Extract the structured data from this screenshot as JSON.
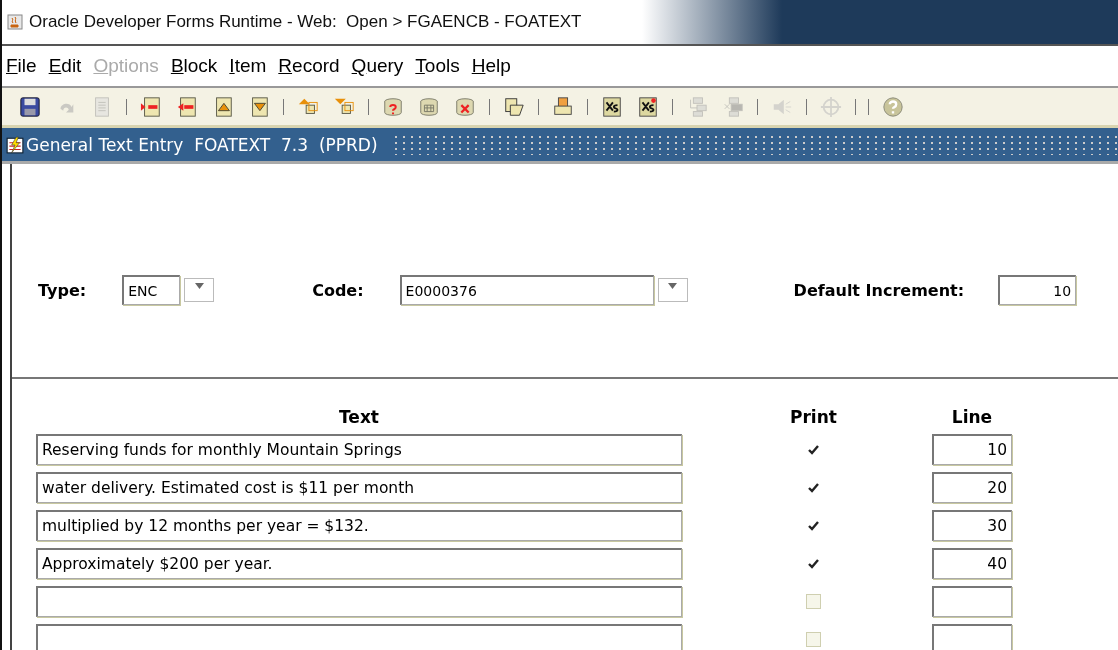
{
  "window": {
    "title": "Oracle Developer Forms Runtime - Web:  Open > FGAENCB - FOATEXT"
  },
  "menu": [
    {
      "label": "File",
      "disabled": false
    },
    {
      "label": "Edit",
      "disabled": false
    },
    {
      "label": "Options",
      "disabled": true
    },
    {
      "label": "Block",
      "disabled": false
    },
    {
      "label": "Item",
      "disabled": false
    },
    {
      "label": "Record",
      "disabled": false
    },
    {
      "label": "Query",
      "disabled": false
    },
    {
      "label": "Tools",
      "disabled": false
    },
    {
      "label": "Help",
      "disabled": false
    }
  ],
  "toolbar": [
    {
      "disabled": false
    },
    {
      "disabled": true
    },
    {
      "disabled": true
    },
    {
      "disabled": false
    },
    {
      "disabled": false
    },
    {
      "disabled": false
    },
    {
      "disabled": false
    },
    {
      "disabled": false
    },
    {
      "disabled": false
    },
    {
      "disabled": false
    },
    {
      "disabled": false
    },
    {
      "disabled": false
    },
    {
      "disabled": false
    },
    {
      "disabled": false
    },
    {
      "disabled": false
    },
    {
      "disabled": false
    },
    {
      "disabled": true
    },
    {
      "disabled": true
    },
    {
      "disabled": true
    },
    {
      "disabled": true
    },
    {
      "disabled": false
    }
  ],
  "form_title": "General Text Entry  FOATEXT  7.3  (PPRD)",
  "key_block": {
    "type": {
      "label": "Type:",
      "value": "ENC"
    },
    "code": {
      "label": "Code:",
      "value": "E0000376"
    },
    "increment": {
      "label": "Default Increment:",
      "value": "10"
    }
  },
  "table": {
    "columns": [
      "Text",
      "Print",
      "Line"
    ],
    "rows": [
      {
        "text": "Reserving funds for monthly Mountain Springs",
        "print": true,
        "line": "10"
      },
      {
        "text": "water delivery. Estimated cost is $11 per month",
        "print": true,
        "line": "20"
      },
      {
        "text": "multiplied by 12 months per year = $132.",
        "print": true,
        "line": "30"
      },
      {
        "text": "Approximately $200 per year.",
        "print": true,
        "line": "40"
      },
      {
        "text": "",
        "print": false,
        "line": ""
      },
      {
        "text": "",
        "print": false,
        "line": ""
      }
    ]
  }
}
